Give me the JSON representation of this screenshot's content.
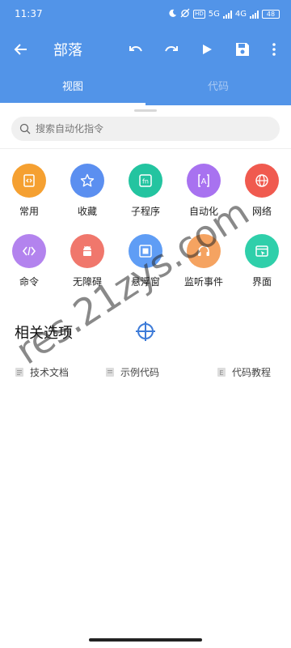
{
  "status_bar": {
    "time": "11:37",
    "hd": "HD",
    "net1": "5G",
    "net2": "4G",
    "battery": "48"
  },
  "app_bar": {
    "title": "部落",
    "icons": [
      "back-arrow-icon",
      "undo-icon",
      "redo-icon",
      "play-icon",
      "save-icon",
      "more-vertical-icon"
    ]
  },
  "tabs": [
    {
      "label": "视图",
      "active": true
    },
    {
      "label": "代码",
      "active": false
    }
  ],
  "search": {
    "placeholder": "搜索自动化指令"
  },
  "categories": [
    {
      "label": "常用",
      "icon": "code-file-icon",
      "color": "#f5a031"
    },
    {
      "label": "收藏",
      "icon": "star-icon",
      "color": "#5b8ff0"
    },
    {
      "label": "子程序",
      "icon": "function-icon",
      "color": "#23c4a0"
    },
    {
      "label": "自动化",
      "icon": "auto-a-icon",
      "color": "#a872f0"
    },
    {
      "label": "网络",
      "icon": "globe-icon",
      "color": "#f05a4f"
    },
    {
      "label": "命令",
      "icon": "code-brackets-icon",
      "color": "#b383ee"
    },
    {
      "label": "无障碍",
      "icon": "android-icon",
      "color": "#f0776c"
    },
    {
      "label": "悬浮窗",
      "icon": "floating-window-icon",
      "color": "#5f9df5"
    },
    {
      "label": "监听事件",
      "icon": "headset-icon",
      "color": "#f5a361"
    },
    {
      "label": "界面",
      "icon": "window-icon",
      "color": "#2fcfaa"
    }
  ],
  "related": {
    "title": "相关选项",
    "items": [
      {
        "label": "技术文档",
        "icon": "document-icon"
      },
      {
        "label": "示例代码",
        "icon": "code-sample-icon"
      },
      {
        "label": "代码教程",
        "icon": "tutorial-icon"
      }
    ]
  },
  "watermark": "res.21zys.com",
  "colors": {
    "primary": "#5294e8",
    "tab_inactive": "#a9c9f3",
    "search_bg": "#f0f0f0"
  }
}
